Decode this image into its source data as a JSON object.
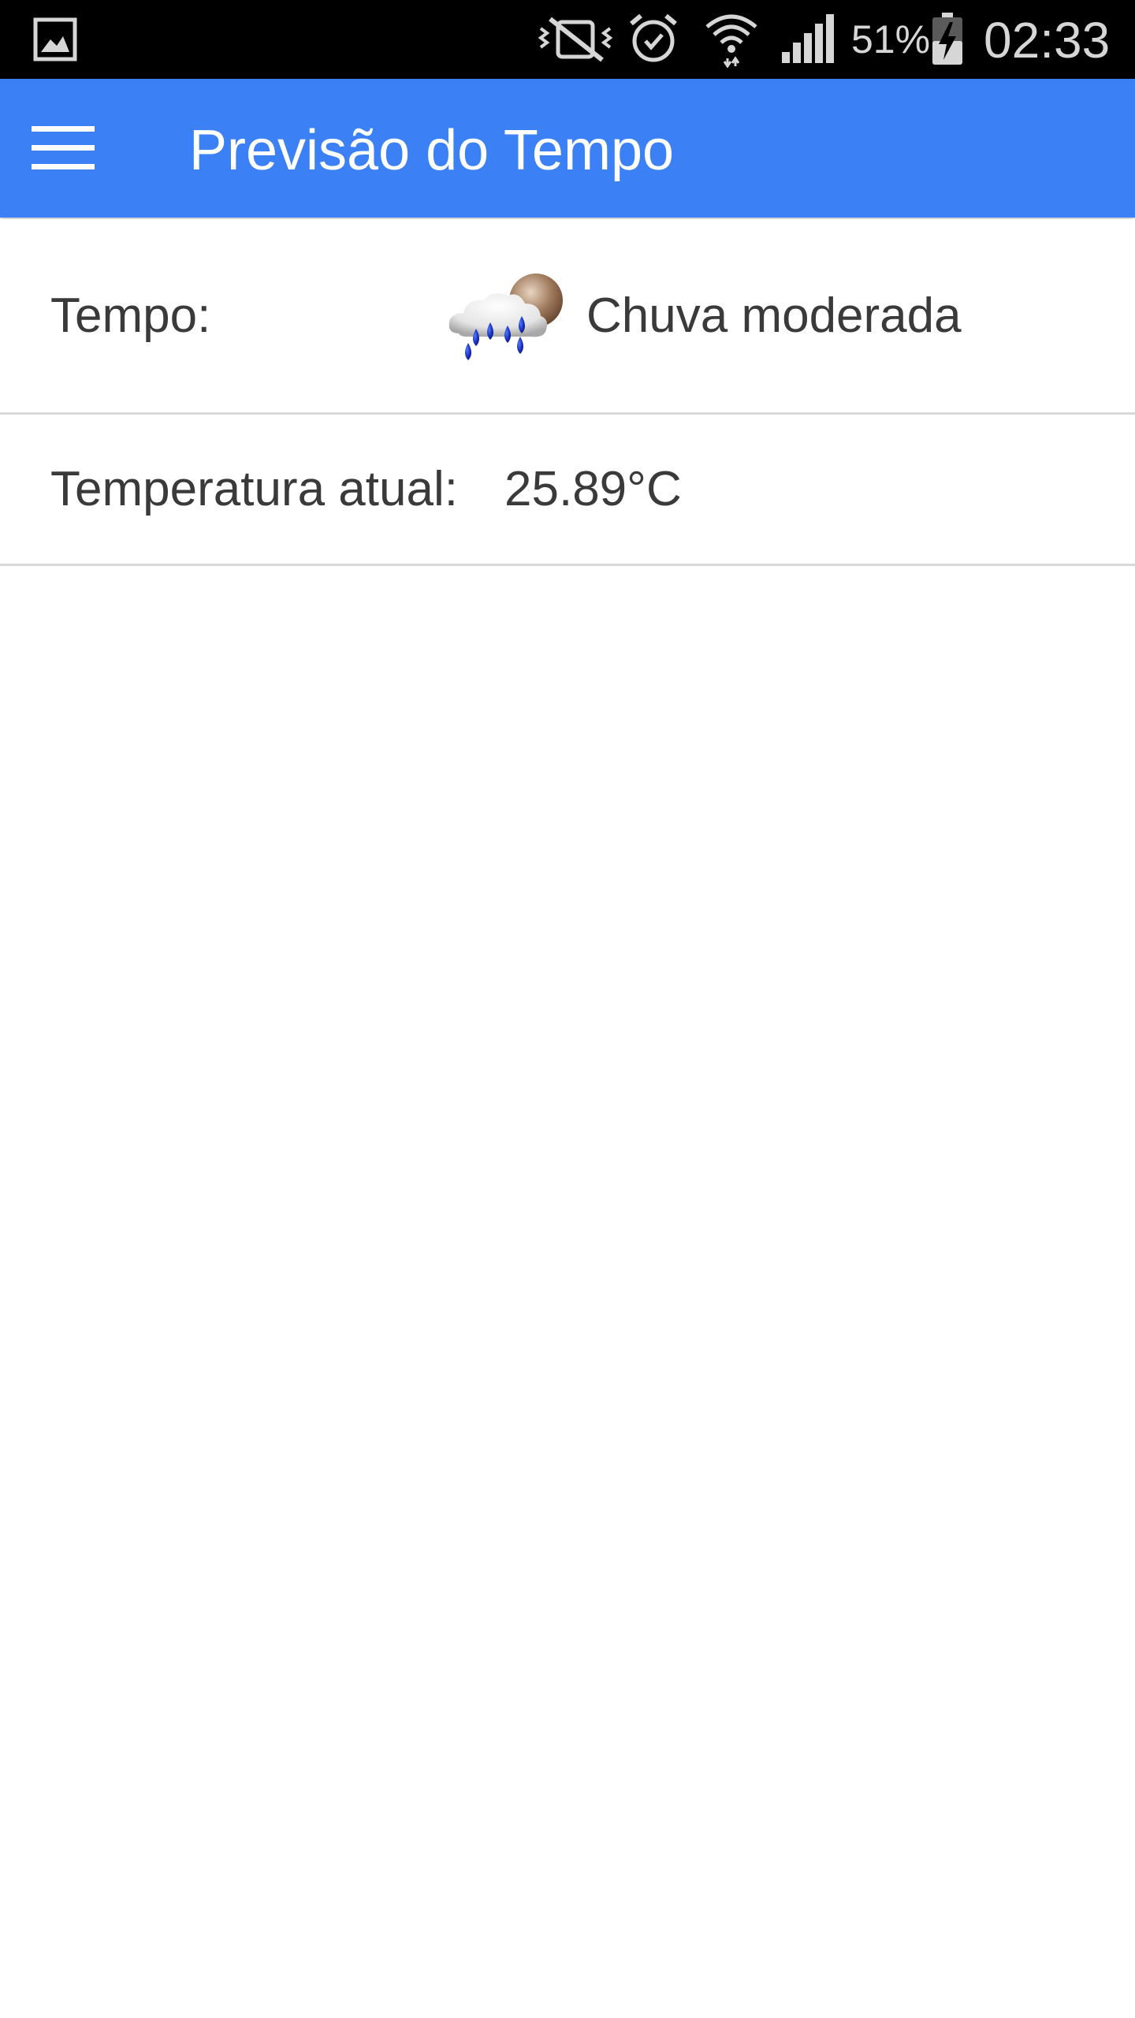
{
  "status_bar": {
    "icons": [
      "gallery-icon",
      "vibrate-mute-icon",
      "alarm-icon",
      "wifi-icon",
      "cellular-signal-icon",
      "battery-charging-icon"
    ],
    "battery_percent": "51%",
    "battery_level": 0.51,
    "time": "02:33"
  },
  "app_bar": {
    "menu_icon": "hamburger-menu-icon",
    "title": "Previsão do Tempo",
    "background_color": "#3b80f4"
  },
  "weather": {
    "label": "Tempo:",
    "icon": "rain-cloud-moon-icon",
    "description": "Chuva moderada"
  },
  "temperature": {
    "label": "Temperatura atual:",
    "value": "25.89°C"
  }
}
